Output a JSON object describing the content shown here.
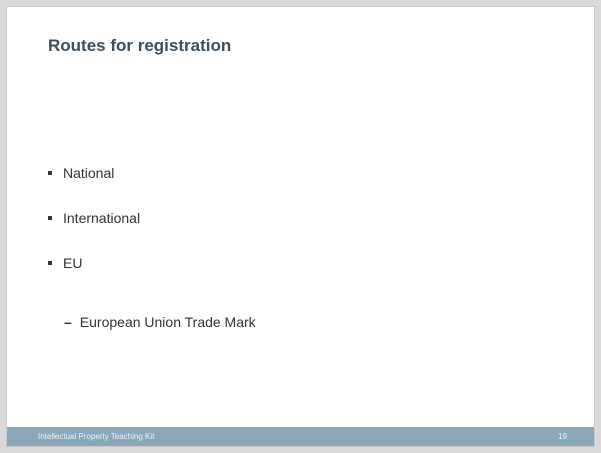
{
  "slide": {
    "title": "Routes for registration",
    "bullets": [
      {
        "label": "National"
      },
      {
        "label": "International"
      },
      {
        "label": "EU"
      }
    ],
    "sub_bullet": {
      "marker": "–",
      "label": "European Union Trade Mark"
    },
    "footer": {
      "label": "Intellectual  Property Teaching Kit",
      "page_number": "19"
    }
  },
  "colors": {
    "title": "#3d4f5c",
    "footer_bar": "#8aa8ba",
    "text": "#333333"
  }
}
